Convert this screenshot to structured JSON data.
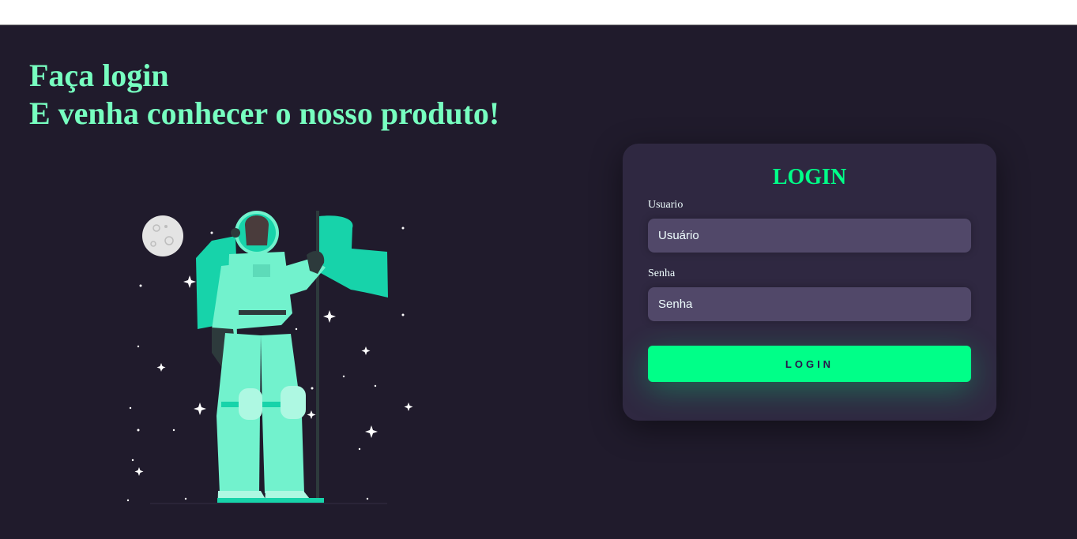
{
  "hero": {
    "line1": "Faça login",
    "line2": "E venha conhecer o nosso produto!"
  },
  "illustration": {
    "icon": "astronaut-with-flag-illustration"
  },
  "login_card": {
    "title": "LOGIN",
    "username_label": "Usuario",
    "username_placeholder": "Usuário",
    "password_label": "Senha",
    "password_placeholder": "Senha",
    "submit_label": "LOGIN"
  },
  "colors": {
    "background": "#201b2c",
    "card": "#2f2841",
    "input": "#514869",
    "accent": "#00ff88",
    "headline": "#77ffc0",
    "illustration": "#6ff0c9"
  }
}
